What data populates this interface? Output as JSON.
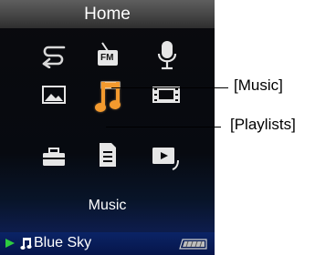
{
  "header": {
    "title": "Home"
  },
  "menu": {
    "icons": [
      "repeat-icon",
      "fm-radio-icon",
      "microphone-icon",
      "photo-icon",
      "music-note-icon",
      "video-icon",
      "settings-toolbox-icon",
      "playlist-icon",
      "video-playlist-icon"
    ],
    "fm_label": "FM",
    "selected_label": "Music"
  },
  "status": {
    "now_playing": "Blue Sky"
  },
  "callouts": {
    "music": "[Music]",
    "playlists": "[Playlists]"
  },
  "colors": {
    "accent": "#f5921e",
    "status_bar": "#0b2466",
    "play_arrow": "#2ecc40"
  }
}
